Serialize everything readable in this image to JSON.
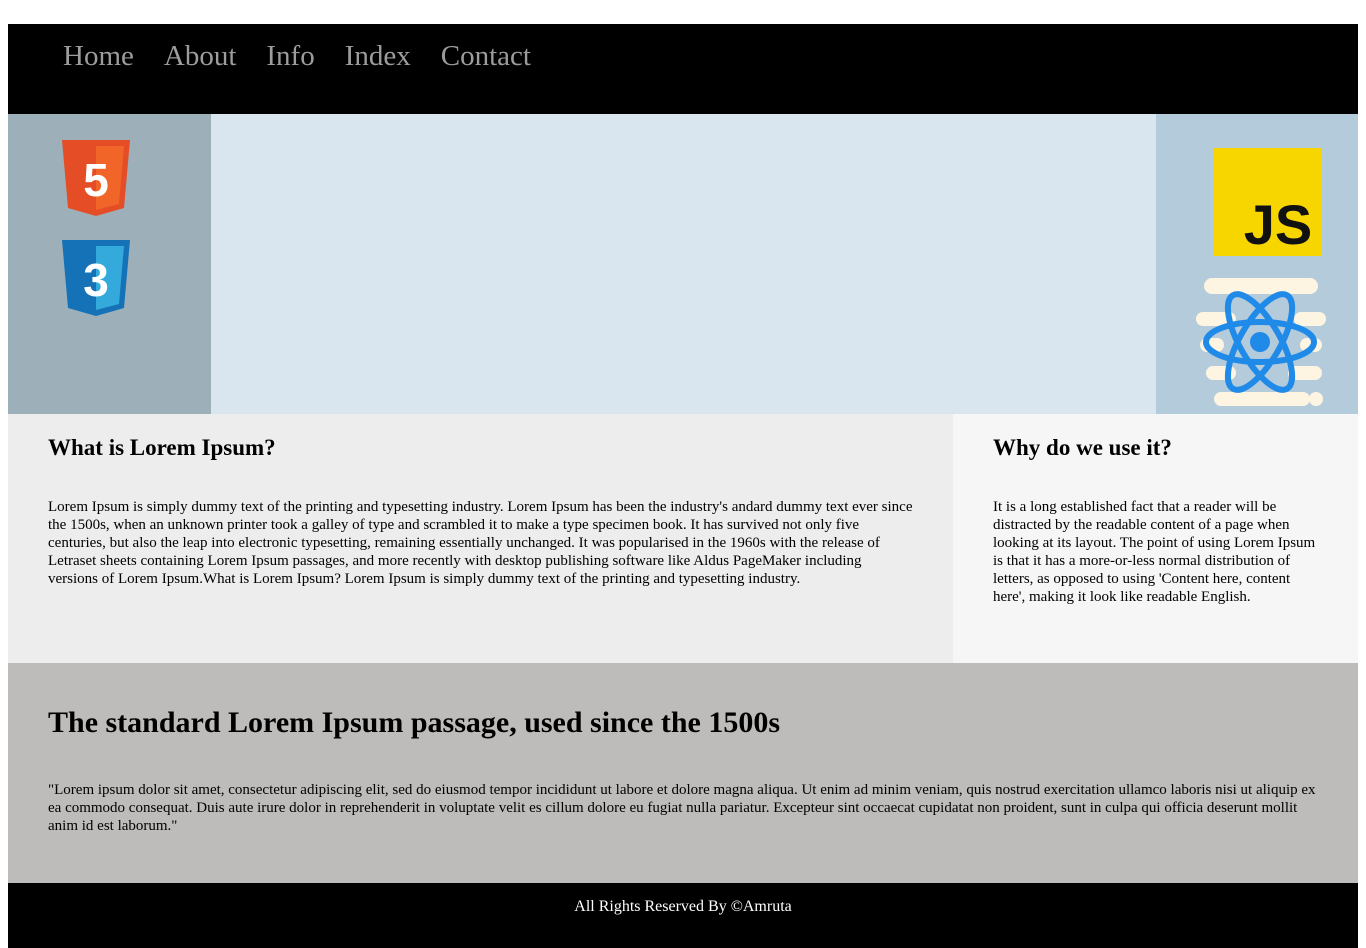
{
  "nav": {
    "items": [
      {
        "label": "Home"
      },
      {
        "label": "About"
      },
      {
        "label": "Info"
      },
      {
        "label": "Index"
      },
      {
        "label": "Contact"
      }
    ]
  },
  "hero": {
    "logos": {
      "html5": "html5-logo-icon",
      "css3": "css3-logo-icon",
      "js": "javascript-logo-icon",
      "react": "react-logo-icon"
    },
    "js_badge_text": "JS",
    "html5_text": "5",
    "css3_text": "3"
  },
  "section_one": {
    "title": "What is Lorem Ipsum?",
    "body": "Lorem Ipsum is simply dummy text of the printing and typesetting industry. Lorem Ipsum has been the industry's andard dummy text ever since the 1500s, when an unknown printer took a galley of type and scrambled it to make a type specimen book. It has survived not only five centuries, but also the leap into electronic typesetting, remaining essentially unchanged. It was popularised in the 1960s with the release of Letraset sheets containing Lorem Ipsum passages, and more recently with desktop publishing software like Aldus PageMaker including versions of Lorem Ipsum.What is Lorem Ipsum? Lorem Ipsum is simply dummy text of the printing and typesetting industry."
  },
  "section_two": {
    "title": "Why do we use it?",
    "body": "It is a long established fact that a reader will be distracted by the readable content of a page when looking at its layout. The point of using Lorem Ipsum is that it has a more-or-less normal distribution of letters, as opposed to using 'Content here, content here', making it look like readable English."
  },
  "standard": {
    "title": "The standard Lorem Ipsum passage, used since the 1500s",
    "body": "\"Lorem ipsum dolor sit amet, consectetur adipiscing elit, sed do eiusmod tempor incididunt ut labore et dolore magna aliqua. Ut enim ad minim veniam, quis nostrud exercitation ullamco laboris nisi ut aliquip ex ea commodo consequat. Duis aute irure dolor in reprehenderit in voluptate velit es cillum dolore eu fugiat nulla pariatur. Excepteur sint occaecat cupidatat non proident, sunt in culpa qui officia deserunt mollit anim id est laborum.\""
  },
  "footer": {
    "text": "All Rights Reserved By ©Amruta"
  },
  "colors": {
    "nav_bg": "#000000",
    "nav_link": "#9c9c9c",
    "hero_left": "#9dafb9",
    "hero_center": "#dae6ef",
    "hero_right": "#b4cbdb",
    "col_main": "#ededed",
    "col_side": "#f6f6f6",
    "standard_bg": "#bebcba",
    "footer_bg": "#000000"
  }
}
